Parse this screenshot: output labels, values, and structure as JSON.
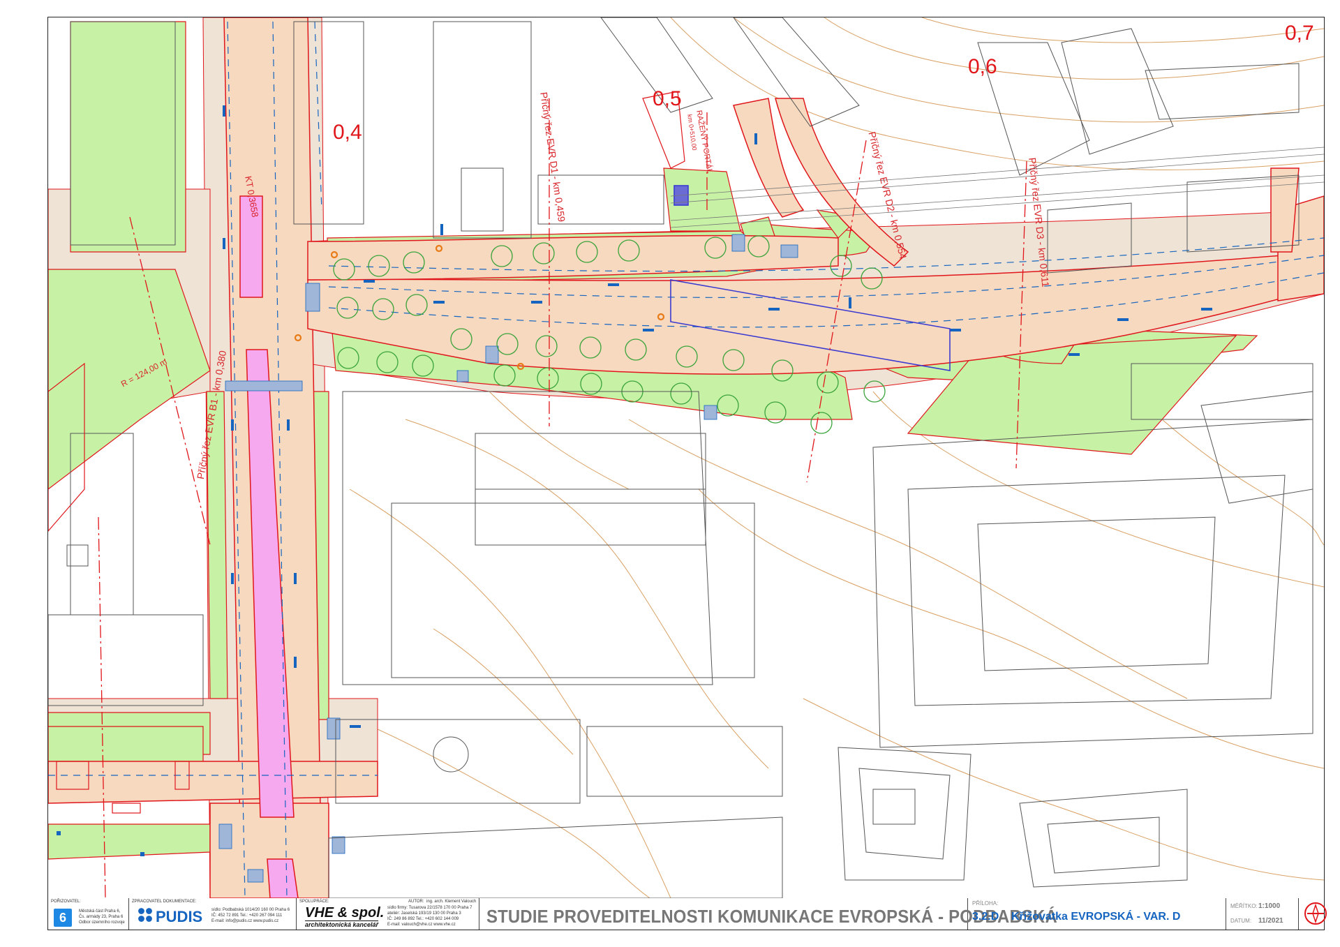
{
  "map": {
    "chainages": [
      "0,4",
      "0,5",
      "0,6",
      "0,7"
    ],
    "labels": {
      "section_d1": "Příčný řez EVR D1 - km 0,459",
      "section_d2": "Příčný řez EVR D2 - km 0,554",
      "section_d3": "Příčný řez EVR D3 - km 0,611",
      "section_b1": "Příčný řez EVR B1 - km 0,380",
      "portal": "RAŽENÝ PORTÁL",
      "portal_km": "km 0+510,00",
      "kt": "KT 0,3658",
      "radius": "R = 124,00 m"
    },
    "colors": {
      "roadway": "#f7d9bf",
      "sidewalk": "#efe3d6",
      "greenery": "#c7f2a6",
      "tramway": "#f6a9ee",
      "boundary": "#e0161b",
      "contours": "#d9a063",
      "buildings": "#555555",
      "lane_arrows": "#1565c0",
      "trees": "#3aa33a"
    }
  },
  "title_block": {
    "porizovatel": {
      "label": "POŘIZOVATEL:",
      "logo": "6",
      "lines": [
        "Městská část Praha 6,",
        "Čs. armády 23, Praha 6",
        "Odbor územního rozvoje"
      ]
    },
    "zpracovatel": {
      "label": "ZPRACOVATEL DOKUMENTACE:",
      "logo": "PUDIS",
      "lines": [
        "sídlo:   Podbabská 1014/20   160 00 Praha 6",
        "IČ: 452 72 891        Tel.: +420 267 094 111",
        "E-mail: info@pudis.cz              www.pudis.cz"
      ]
    },
    "spoluprace": {
      "label": "SPOLUPRÁCE:",
      "logo": "VHE & spol.",
      "logo_sub": "architektonická kancelář",
      "author_label": "AUTOR:",
      "author": "ing. arch. Klement Valouch",
      "lines": [
        "sídlo firmy: Tusarova 22/1578 170 00 Praha 7",
        "ateliér: Jaselská 193/19       130 00 Praha 3",
        "IČ: 249 86 892          Tel.: +420 602 144 009",
        "E-mail: valouch@vhe.cz              www.vhe.cz"
      ]
    },
    "main_title": "STUDIE PROVEDITELNOSTI KOMUNIKACE EVROPSKÁ - PODBABSKÁ",
    "priloha_label": "PŘÍLOHA:",
    "priloha_number": "3.2.D",
    "priloha_title": "Křižovatka EVROPSKÁ - VAR. D",
    "meritko_label": "MĚŘÍTKO:",
    "meritko": "1:1000",
    "datum_label": "DATUM:",
    "datum": "11/2021"
  }
}
